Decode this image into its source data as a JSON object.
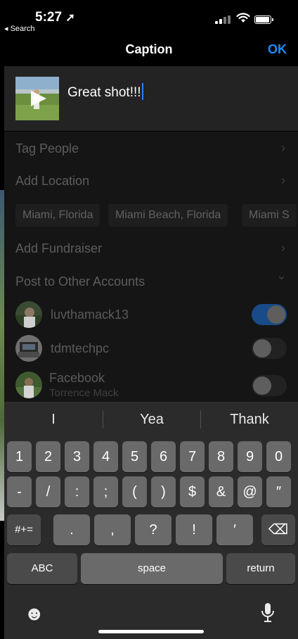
{
  "status_bar": {
    "time": "5:27",
    "location_arrow": "➚",
    "back_to_app": "◂ Search",
    "signal_icon": "cellular-signal-icon",
    "wifi_icon": "wifi-icon",
    "battery_icon": "battery-icon"
  },
  "nav": {
    "title": "Caption",
    "ok_label": "OK"
  },
  "caption": {
    "text": "Great shot!!!",
    "thumbnail_icon": "video-thumbnail-play-icon"
  },
  "options": {
    "tag_people": "Tag People",
    "add_location": "Add Location",
    "location_suggestions": [
      "Miami, Florida",
      "Miami Beach, Florida",
      "Miami S"
    ],
    "add_fundraiser": "Add Fundraiser",
    "post_to_other_accounts": "Post to Other Accounts",
    "chevron_right": "›",
    "chevron_down": "⌄"
  },
  "accounts": [
    {
      "name": "luvthamack13",
      "subtitle": "",
      "toggle_on": true
    },
    {
      "name": "tdmtechpc",
      "subtitle": "",
      "toggle_on": false
    },
    {
      "name": "Facebook",
      "subtitle": "Torrence Mack",
      "toggle_on": false
    }
  ],
  "keyboard": {
    "suggestions": [
      "I",
      "Yea",
      "Thank"
    ],
    "row1": [
      "1",
      "2",
      "3",
      "4",
      "5",
      "6",
      "7",
      "8",
      "9",
      "0"
    ],
    "row2": [
      "-",
      "/",
      ":",
      ";",
      "(",
      ")",
      "$",
      "&",
      "@",
      "″"
    ],
    "mode_key": "#+=",
    "row3": [
      ".",
      ",",
      "?",
      "!",
      "′"
    ],
    "delete_icon": "⌫",
    "abc_label": "ABC",
    "space_label": "space",
    "return_label": "return",
    "emoji_icon": "☻",
    "mic_icon": "microphone-icon"
  },
  "colors": {
    "accent": "#1a8cff",
    "cursor": "#2f7cf6",
    "toggle_on": "#184b87"
  }
}
